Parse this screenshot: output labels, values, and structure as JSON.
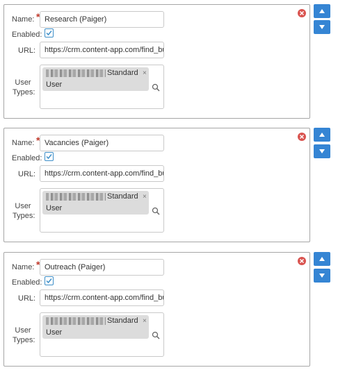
{
  "labels": {
    "name": "Name:",
    "required": "*",
    "enabled": "Enabled:",
    "url": "URL:",
    "user_types": "User Types:"
  },
  "entries": [
    {
      "name": "Research (Paiger)",
      "enabled": true,
      "url": "https://crm.content-app.com/find_bu",
      "user_type_tag": {
        "line1": "Standard",
        "line2": "User",
        "remove_glyph": "×"
      }
    },
    {
      "name": "Vacancies (Paiger)",
      "enabled": true,
      "url": "https://crm.content-app.com/find_bu",
      "user_type_tag": {
        "line1": "Standard",
        "line2": "User",
        "remove_glyph": "×"
      }
    },
    {
      "name": "Outreach (Paiger)",
      "enabled": true,
      "url": "https://crm.content-app.com/find_bu",
      "user_type_tag": {
        "line1": "Standard",
        "line2": "User",
        "remove_glyph": "×"
      }
    }
  ],
  "icons": {
    "remove": "remove-circle-icon",
    "move_up": "arrow-up-icon",
    "move_down": "arrow-down-icon",
    "search": "search-icon",
    "check": "checkmark-icon"
  },
  "colors": {
    "accent_blue": "#3585d4",
    "remove_red": "#d9534f",
    "required_red": "#c0392b",
    "card_border": "#a6a6a6",
    "tag_bg": "#dcdcdc"
  }
}
